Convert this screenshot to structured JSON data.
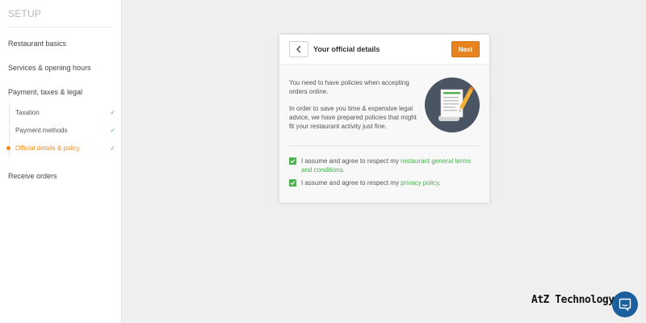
{
  "sidebar": {
    "title": "SETUP",
    "items": [
      {
        "label": "Restaurant basics"
      },
      {
        "label": "Services & opening hours"
      },
      {
        "label": "Payment, taxes & legal"
      },
      {
        "label": "Receive orders"
      }
    ],
    "sub_items": [
      {
        "label": "Taxation",
        "check": "✓",
        "done": true
      },
      {
        "label": "Payment methods",
        "check": "✓",
        "done": true
      },
      {
        "label": "Official details & policy",
        "check": "✓",
        "active": true
      }
    ]
  },
  "card": {
    "title": "Your official details",
    "next_label": "Next",
    "intro": "You need to have policies when accepting orders online.",
    "policy_note": "In order to save you time & expensive legal advice, we have prepared policies that might fit your restaurant activity just fine.",
    "consent_prefix": "I assume and agree to respect my ",
    "terms_link": "restaurant general terms and conditions",
    "privacy_link": "privacy policy",
    "period": "."
  },
  "colors": {
    "accent": "#e7841d",
    "link": "#4caf50",
    "illustration_circle": "#4a5563",
    "chat_button": "#1b5f9c"
  },
  "icons": {
    "back": "chevron-left-icon",
    "check": "check-icon",
    "document": "document-pen-icon",
    "chat": "chat-icon"
  },
  "watermark": "AtZ Technology"
}
